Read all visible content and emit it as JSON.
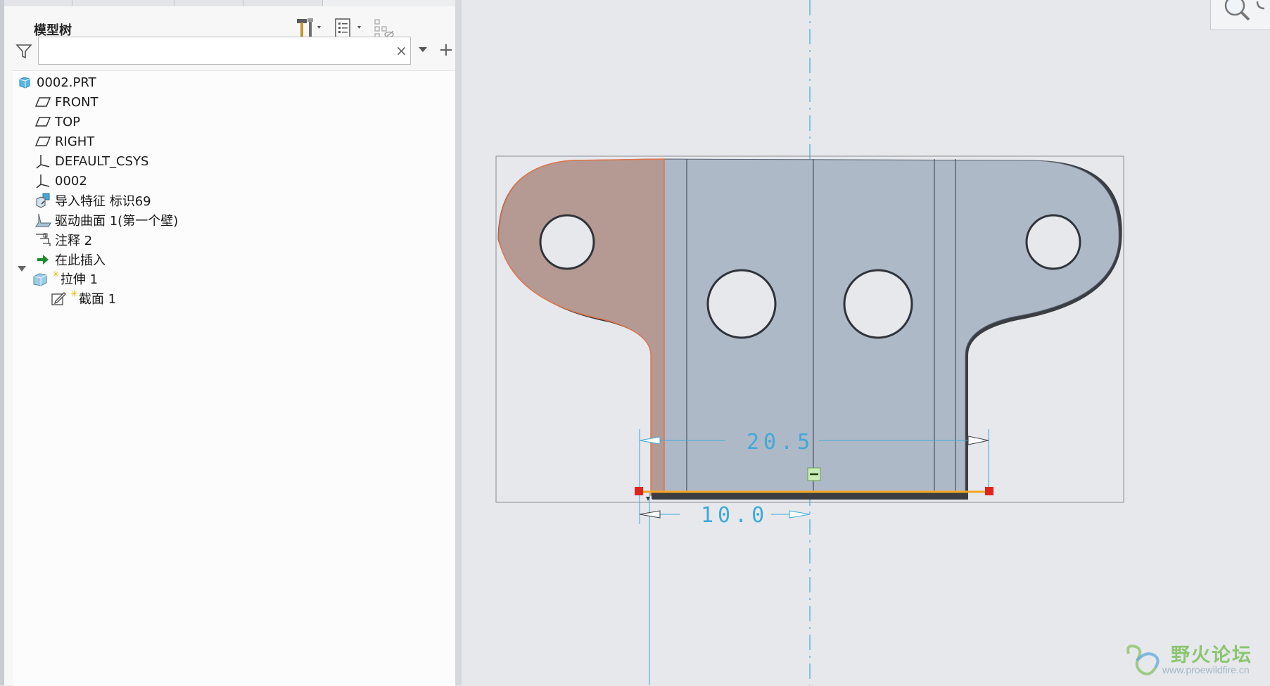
{
  "panel": {
    "title": "模型树",
    "search": {
      "value": "",
      "placeholder": ""
    },
    "clear_glyph": "×",
    "add_glyph": "+"
  },
  "tree": {
    "items": [
      {
        "label": "0002.PRT",
        "icon": "part-icon",
        "new": false
      },
      {
        "label": "FRONT",
        "icon": "datum-plane-icon",
        "new": false
      },
      {
        "label": "TOP",
        "icon": "datum-plane-icon",
        "new": false
      },
      {
        "label": "RIGHT",
        "icon": "datum-plane-icon",
        "new": false
      },
      {
        "label": "DEFAULT_CSYS",
        "icon": "coordinate-system-icon",
        "new": false
      },
      {
        "label": "0002",
        "icon": "coordinate-system-icon",
        "new": false
      },
      {
        "label": "导入特征 标识69",
        "icon": "import-feature-icon",
        "new": false
      },
      {
        "label": "驱动曲面 1(第一个壁)",
        "icon": "driving-surface-icon",
        "new": false
      },
      {
        "label": "注释 2",
        "icon": "annotation-icon",
        "new": false
      },
      {
        "label": "在此插入",
        "icon": "insert-here-arrow-icon",
        "new": false
      },
      {
        "label": "拉伸 1",
        "icon": "extrude-icon",
        "new": true,
        "expanded": true
      },
      {
        "label": "截面 1",
        "icon": "sketch-icon",
        "new": true
      }
    ]
  },
  "graphics": {
    "dimensions": [
      {
        "value": "20.5"
      },
      {
        "value": "10.0"
      }
    ],
    "colors": {
      "part_fill": "#aeb9c8",
      "selected_fill": "#b49a93",
      "selected_edge": "#e0734a",
      "sketch_line": "#f5a623",
      "dimension": "#3fa9d8",
      "handle": "#e0241b",
      "centerline": "#3fa9d8"
    }
  },
  "watermark": {
    "title": "野火论坛",
    "url": "www.proewildfire.cn"
  }
}
